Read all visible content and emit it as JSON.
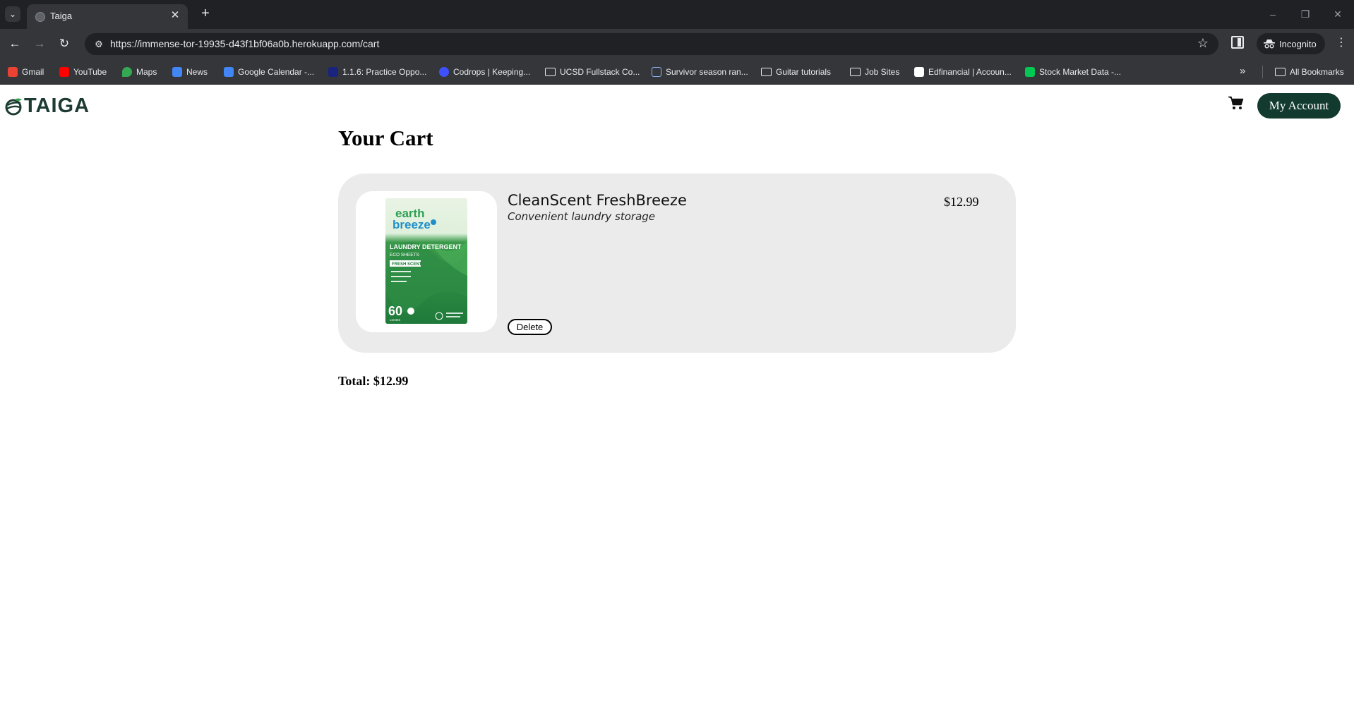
{
  "browser": {
    "tab_title": "Taiga",
    "url": "https://immense-tor-19935-d43f1bf06a0b.herokuapp.com/cart",
    "profile_label": "Incognito",
    "bookmarks": [
      {
        "label": "Gmail",
        "icon": "gmail-icon",
        "color": "#ea4335"
      },
      {
        "label": "YouTube",
        "icon": "youtube-icon",
        "color": "#ff0000"
      },
      {
        "label": "Maps",
        "icon": "maps-icon",
        "color": "#34a853"
      },
      {
        "label": "News",
        "icon": "news-icon",
        "color": "#4285f4"
      },
      {
        "label": "Google Calendar -...",
        "icon": "calendar-icon",
        "color": "#4285f4"
      },
      {
        "label": "1.1.6: Practice Oppo...",
        "icon": "site-icon",
        "color": "#1a237e"
      },
      {
        "label": "Codrops | Keeping...",
        "icon": "codrops-icon",
        "color": "#3f51ff"
      },
      {
        "label": "UCSD Fullstack Co...",
        "icon": "folder-icon",
        "color": ""
      },
      {
        "label": "Survivor season ran...",
        "icon": "sheets-icon",
        "color": "#8ab4f8"
      },
      {
        "label": "Guitar tutorials",
        "icon": "folder-icon",
        "color": ""
      },
      {
        "label": "Job Sites",
        "icon": "folder-icon",
        "color": ""
      },
      {
        "label": "Edfinancial | Accoun...",
        "icon": "edfinancial-icon",
        "color": "#ffffff"
      },
      {
        "label": "Stock Market Data -...",
        "icon": "stock-icon",
        "color": "#00c853"
      }
    ],
    "all_bookmarks_label": "All Bookmarks"
  },
  "site": {
    "logo_text": "TAIGA",
    "account_label": "My Account",
    "brand_color": "#123a2e"
  },
  "cart": {
    "title": "Your Cart",
    "items": [
      {
        "name": "CleanScent FreshBreeze",
        "description": "Convenient laundry storage",
        "price": "$12.99",
        "delete_label": "Delete",
        "image": {
          "brand_line1": "earth",
          "brand_line2": "breeze",
          "product_line1": "LAUNDRY DETERGENT",
          "product_line2": "ECO SHEETS",
          "scent": "FRESH SCENT",
          "count": "60",
          "count_unit": "LOADS"
        }
      }
    ],
    "total_label": "Total: $12.99"
  }
}
